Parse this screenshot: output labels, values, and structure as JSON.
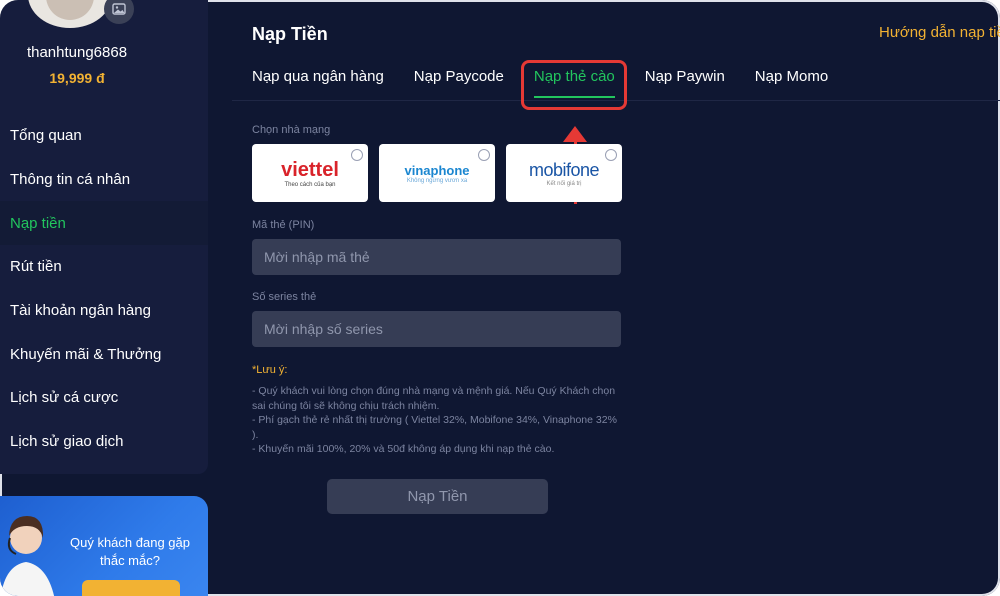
{
  "user": {
    "name": "thanhtung6868",
    "balance": "19,999 đ"
  },
  "sidebar": {
    "items": [
      {
        "label": "Tổng quan"
      },
      {
        "label": "Thông tin cá nhân"
      },
      {
        "label": "Nạp tiền",
        "active": true
      },
      {
        "label": "Rút tiền"
      },
      {
        "label": "Tài khoản ngân hàng"
      },
      {
        "label": "Khuyến mãi & Thưởng"
      },
      {
        "label": "Lịch sử cá cược"
      },
      {
        "label": "Lịch sử giao dịch"
      }
    ],
    "promo_text": "Quý khách đang gặp thắc mắc?"
  },
  "main": {
    "title": "Nạp Tiền",
    "guide_link": "Hướng dẫn nạp tiề",
    "tabs": [
      {
        "label": "Nạp qua ngân hàng"
      },
      {
        "label": "Nạp Paycode"
      },
      {
        "label": "Nạp thẻ cào",
        "active": true
      },
      {
        "label": "Nạp Paywin"
      },
      {
        "label": "Nạp Momo"
      }
    ],
    "carrier_label": "Chọn nhà mạng",
    "carriers": [
      {
        "name": "viettel",
        "tagline": "Theo cách của bạn"
      },
      {
        "name": "vinaphone",
        "tagline": "Không ngừng vươn xa"
      },
      {
        "name": "mobifone",
        "tagline": "Kết nối giá trị"
      }
    ],
    "pin_label": "Mã thẻ (PIN)",
    "pin_placeholder": "Mời nhập mã thẻ",
    "serial_label": "Số series thẻ",
    "serial_placeholder": "Mời nhập số series",
    "note_title": "*Lưu ý:",
    "note_text": "- Quý khách vui lòng chọn đúng nhà mạng và mệnh giá. Nếu Quý Khách chọn sai chúng tôi sẽ không chịu trách nhiệm.\n- Phí gạch thẻ rẻ nhất thị trường ( Viettel 32%, Mobifone 34%, Vinaphone 32% ).\n- Khuyến mãi 100%, 20% và 50đ không áp dụng khi nạp thẻ cào.",
    "submit_label": "Nạp Tiền"
  },
  "colors": {
    "background": "#0f1732",
    "accent_green": "#22c55e",
    "accent_gold": "#f2b233",
    "highlight_red": "#e53935"
  }
}
